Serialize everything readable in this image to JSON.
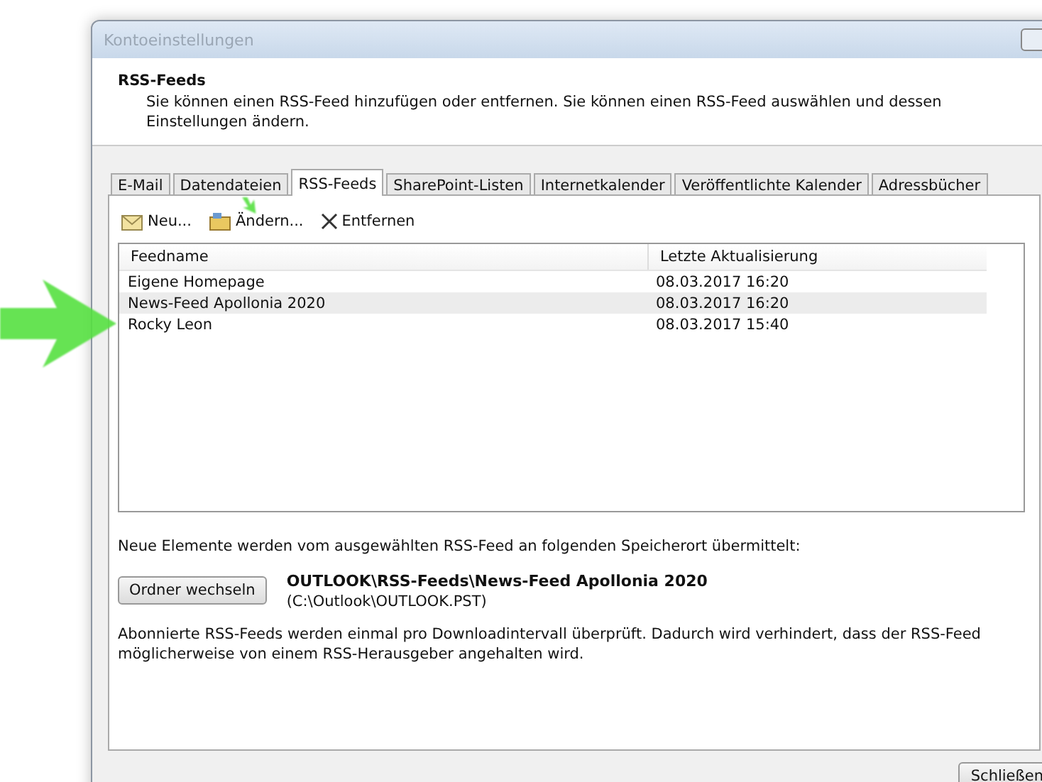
{
  "window": {
    "title": "Kontoeinstellungen"
  },
  "header": {
    "title": "RSS-Feeds",
    "description": "Sie können einen RSS-Feed hinzufügen oder entfernen. Sie können einen RSS-Feed auswählen und dessen Einstellungen ändern."
  },
  "tabs": [
    {
      "label": "E-Mail",
      "selected": false
    },
    {
      "label": "Datendateien",
      "selected": false
    },
    {
      "label": "RSS-Feeds",
      "selected": true
    },
    {
      "label": "SharePoint-Listen",
      "selected": false
    },
    {
      "label": "Internetkalender",
      "selected": false
    },
    {
      "label": "Veröffentlichte Kalender",
      "selected": false
    },
    {
      "label": "Adressbücher",
      "selected": false
    }
  ],
  "toolbar": [
    {
      "kind": "new",
      "label": "Neu..."
    },
    {
      "kind": "edit",
      "label": "Ändern..."
    },
    {
      "kind": "remove",
      "label": "Entfernen"
    }
  ],
  "table": {
    "columns": [
      "Feedname",
      "Letzte Aktualisierung"
    ],
    "rows": [
      {
        "feedname": "Eigene Homepage",
        "updated": "08.03.2017 16:20",
        "selected": false
      },
      {
        "feedname": "News-Feed Apollonia 2020",
        "updated": "08.03.2017 16:20",
        "selected": true
      },
      {
        "feedname": "Rocky Leon",
        "updated": "08.03.2017 15:40",
        "selected": false
      }
    ]
  },
  "location_note": "Neue Elemente werden vom ausgewählten RSS-Feed an folgenden Speicherort übermittelt:",
  "change_folder_button": "Ordner wechseln",
  "folder_path": "OUTLOOK\\RSS-Feeds\\News-Feed Apollonia 2020",
  "folder_file": "(C:\\Outlook\\OUTLOOK.PST)",
  "info_text": "Abonnierte RSS-Feeds werden einmal pro Downloadintervall überprüft. Dadurch wird verhindert, dass der RSS-Feed möglicherweise von einem RSS-Herausgeber angehalten wird.",
  "close_button": "Schließen"
}
